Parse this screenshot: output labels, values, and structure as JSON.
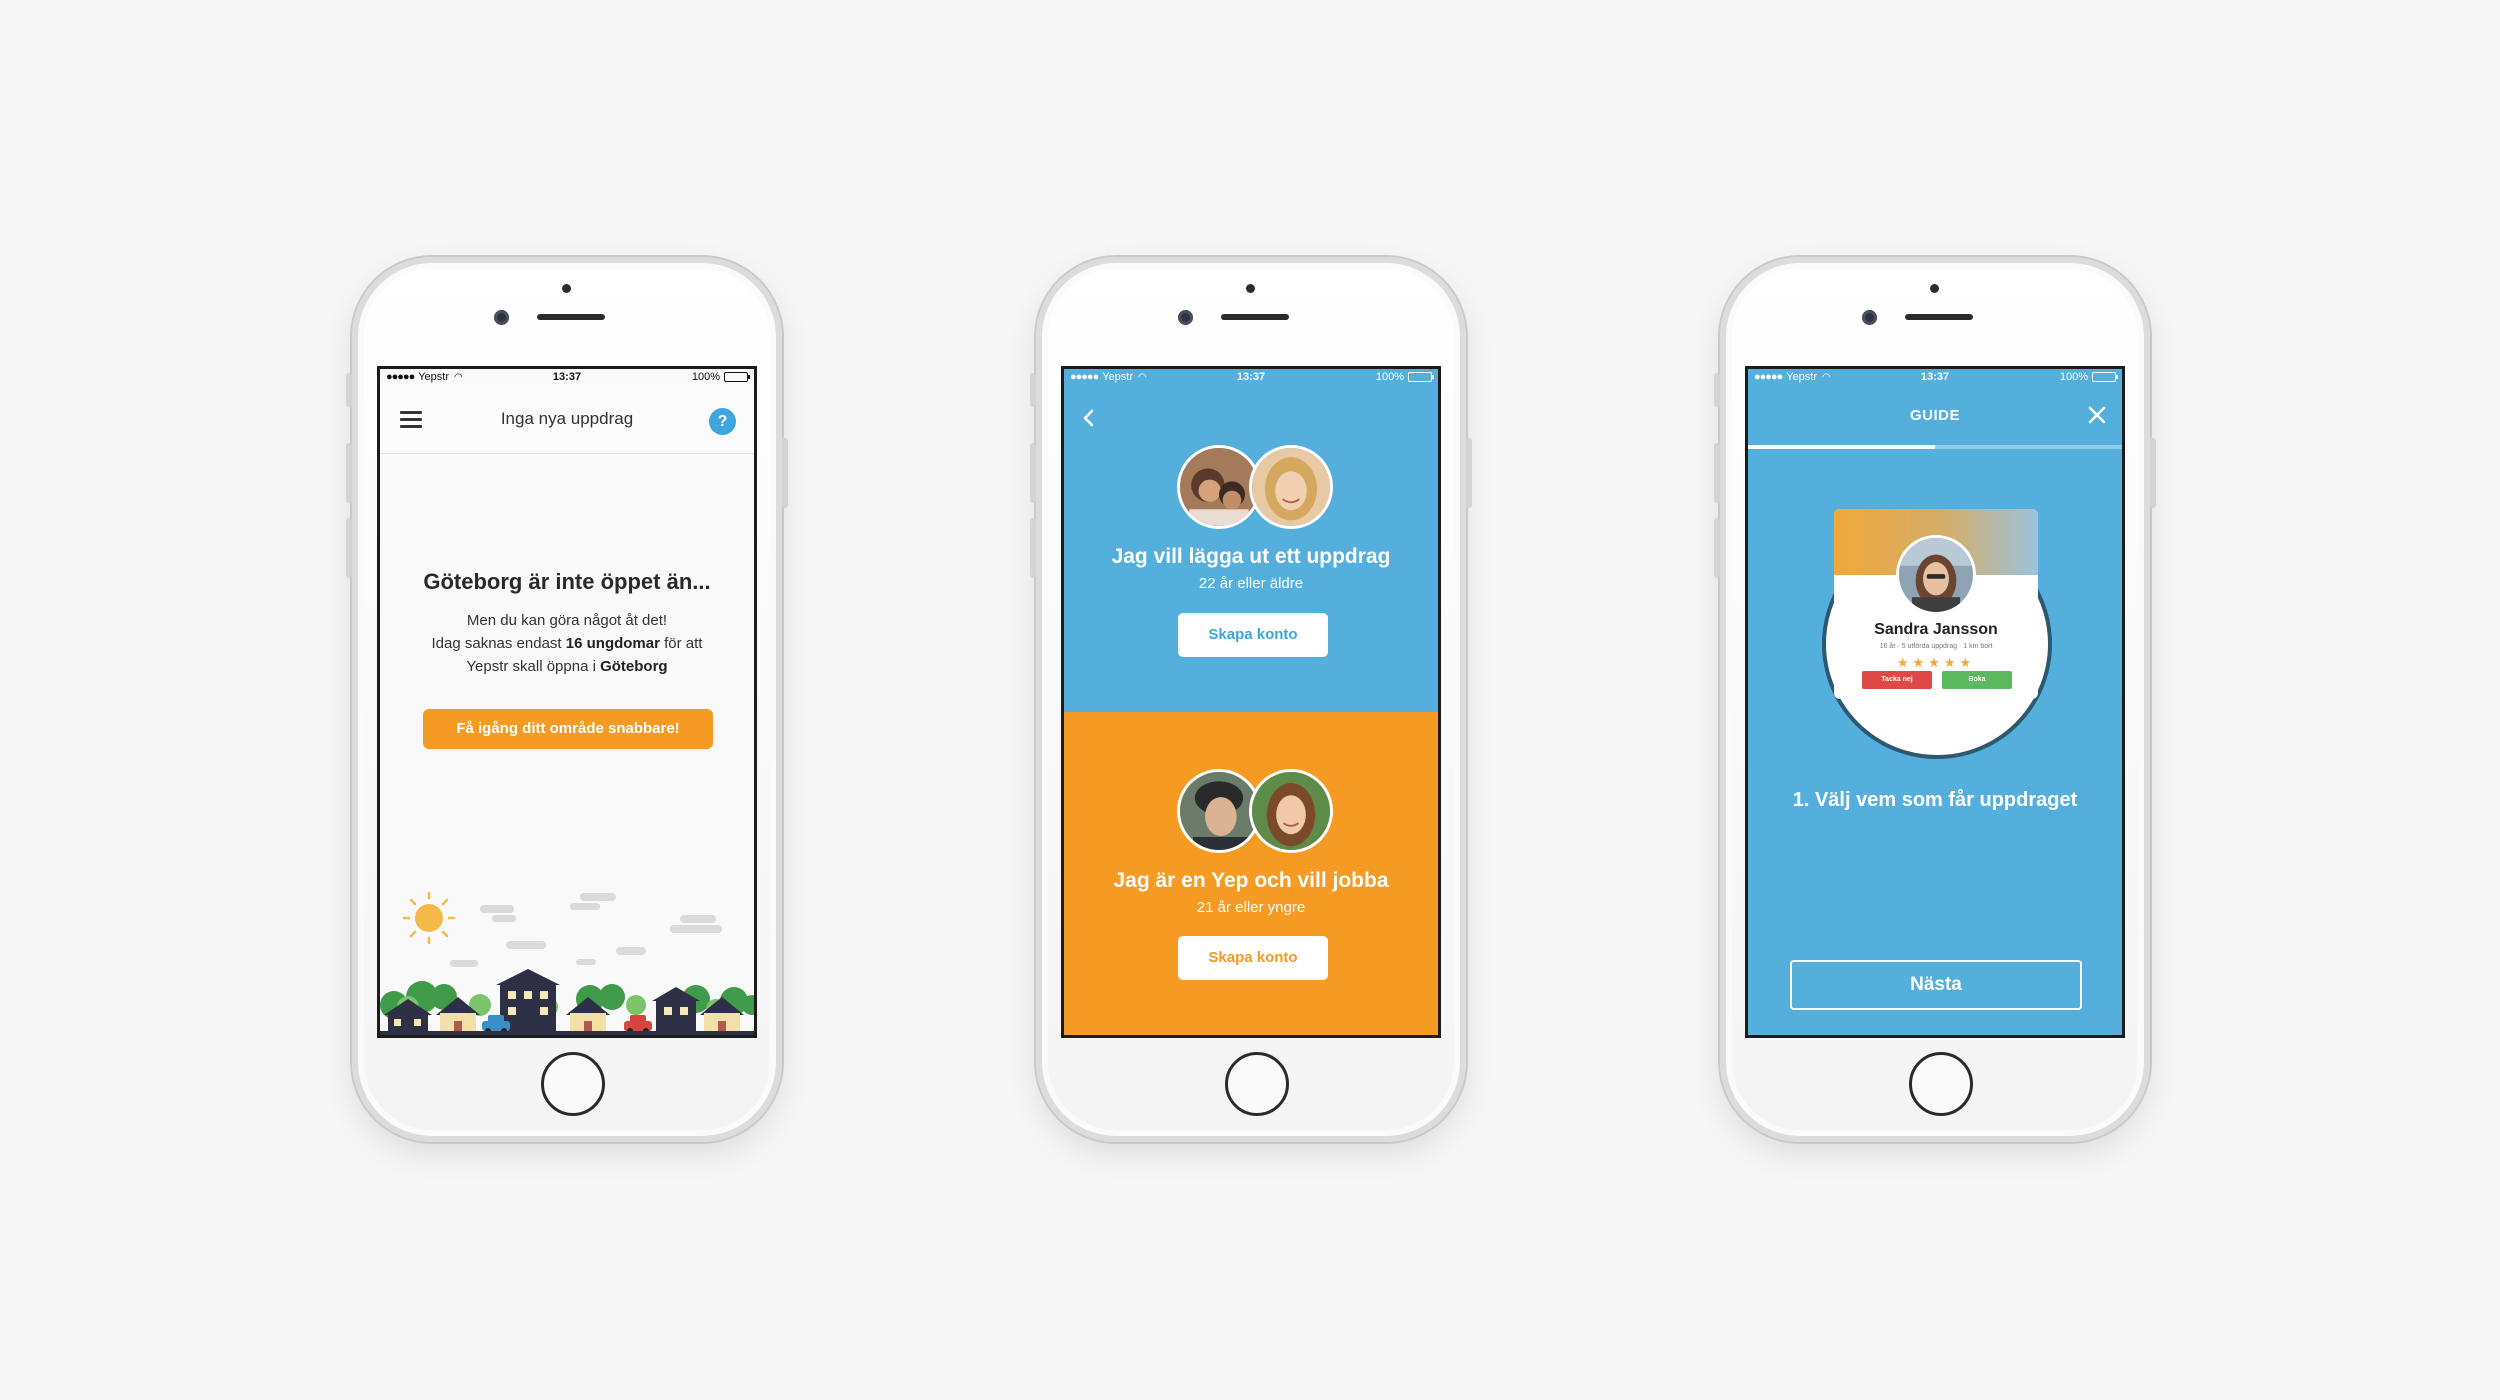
{
  "status_bar": {
    "signal": "●●●●●",
    "carrier": "Yepstr",
    "time": "13:37",
    "battery": "100%"
  },
  "screen_empty": {
    "nav_title": "Inga nya uppdrag",
    "help_label": "?",
    "title": "Göteborg är inte öppet än...",
    "body_line1": "Men du kan göra något åt det!",
    "body_line2_pre": "Idag saknas endast ",
    "body_line2_bold": "16 ungdomar",
    "body_line2_post": " för att",
    "body_line3_pre": "Yepstr skall öppna i ",
    "body_line3_bold": "Göteborg",
    "cta_label": "Få igång ditt område snabbare!"
  },
  "screen_roles": {
    "employer": {
      "title": "Jag vill lägga ut ett uppdrag",
      "subtitle": "22 år eller äldre",
      "button_label": "Skapa konto"
    },
    "worker": {
      "title": "Jag är en Yep och vill jobba",
      "subtitle": "21 år eller yngre",
      "button_label": "Skapa konto"
    }
  },
  "screen_guide": {
    "title": "GUIDE",
    "progress": 0.5,
    "card": {
      "name": "Sandra Jansson",
      "meta": "16 år · 5 utförda uppdrag · 1 km bort",
      "stars": "★★★★★",
      "rating": 5,
      "decline_label": "Tacka nej",
      "book_label": "Boka"
    },
    "step_text": "1. Välj vem som får uppdraget",
    "next_label": "Nästa"
  },
  "colors": {
    "blue": "#55afdc",
    "orange": "#f59a23",
    "help_blue": "#3ea6dd",
    "red": "#e04848",
    "green": "#5cb85c"
  }
}
